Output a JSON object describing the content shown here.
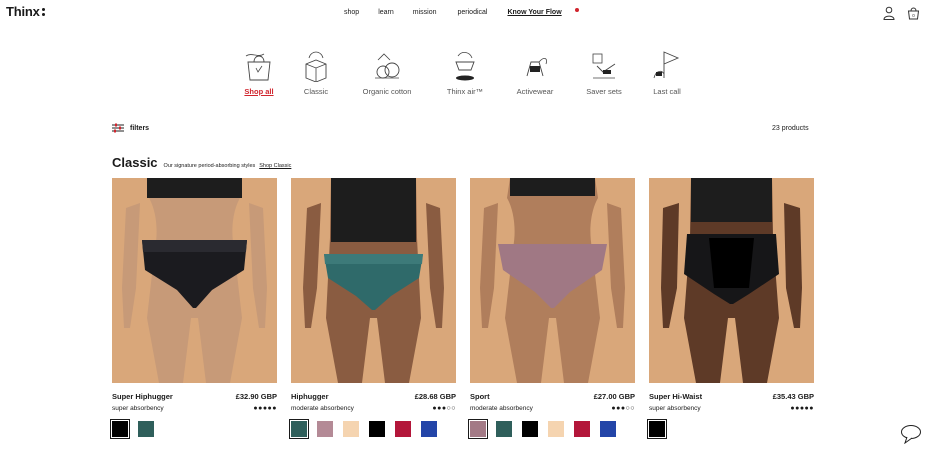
{
  "header": {
    "logo": "Thinx",
    "nav": [
      "shop",
      "learn",
      "mission",
      "periodical",
      "Know Your Flow"
    ]
  },
  "categories": [
    {
      "label": "Shop all",
      "active": true
    },
    {
      "label": "Classic",
      "active": false
    },
    {
      "label": "Organic cotton",
      "active": false
    },
    {
      "label": "Thinx air™",
      "active": false
    },
    {
      "label": "Activewear",
      "active": false
    },
    {
      "label": "Saver sets",
      "active": false
    },
    {
      "label": "Last call",
      "active": false
    }
  ],
  "toolbar": {
    "filters_label": "filters",
    "product_count": "23 products"
  },
  "section": {
    "title": "Classic",
    "subtitle": "Our signature period-absorbing styles",
    "link": "Shop Classic"
  },
  "products": [
    {
      "name": "Super Hiphugger",
      "price": "£32.90 GBP",
      "absorbency": "super absorbency",
      "drops": "●●●●●",
      "swatches": [
        "#000000",
        "#2f5f5b"
      ]
    },
    {
      "name": "Hiphugger",
      "price": "£28.68 GBP",
      "absorbency": "moderate absorbency",
      "drops": "●●●○○",
      "swatches": [
        "#2f5f5b",
        "#b48a96",
        "#f5d4b0",
        "#000000",
        "#b3163a",
        "#2345a8"
      ]
    },
    {
      "name": "Sport",
      "price": "£27.00 GBP",
      "absorbency": "moderate absorbency",
      "drops": "●●●○○",
      "swatches": [
        "#a37a86",
        "#2f5f5b",
        "#000000",
        "#f5d4b0",
        "#b3163a",
        "#2345a8"
      ]
    },
    {
      "name": "Super Hi-Waist",
      "price": "£35.43 GBP",
      "absorbency": "super absorbency",
      "drops": "●●●●●",
      "swatches": [
        "#000000"
      ]
    }
  ],
  "colors": {
    "accent": "#d0242d",
    "photo_bg": "#d9a77a"
  }
}
